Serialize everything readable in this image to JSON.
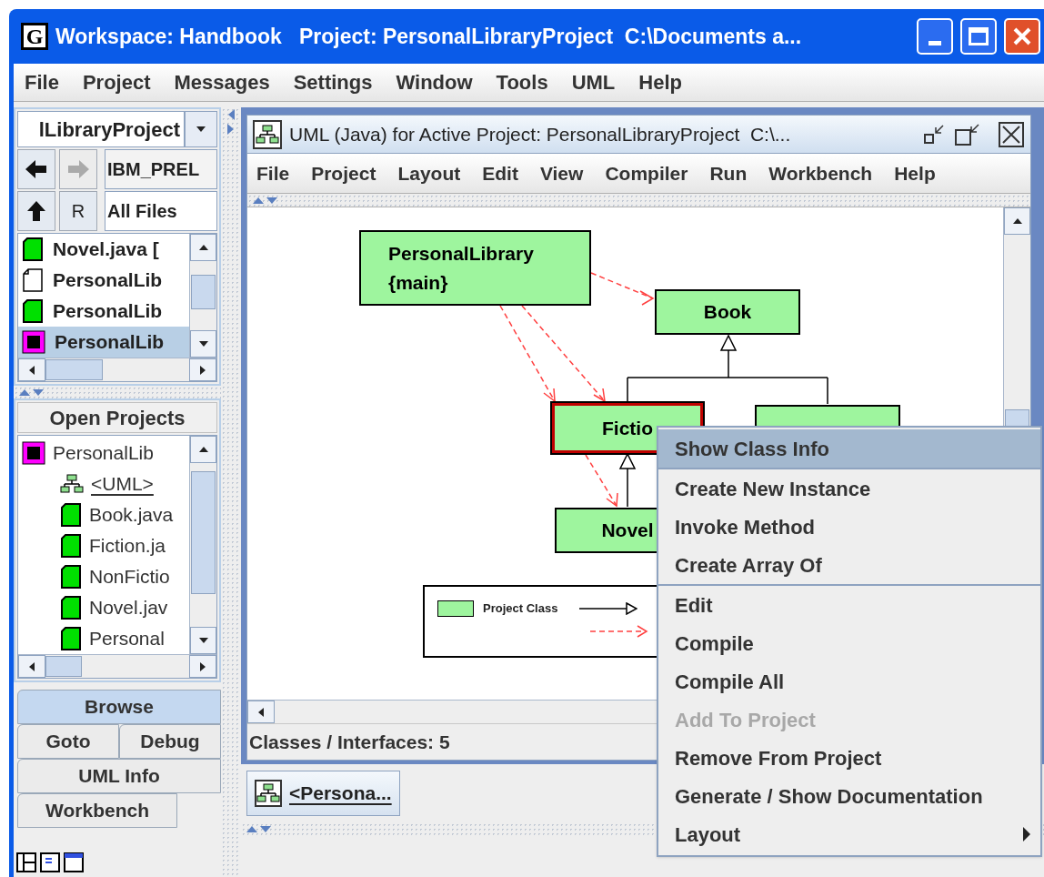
{
  "window": {
    "app_icon": "G",
    "title": "Workspace: Handbook   Project: PersonalLibraryProject  C:\\Documents a..."
  },
  "menubar": [
    "File",
    "Project",
    "Messages",
    "Settings",
    "Window",
    "Tools",
    "UML",
    "Help"
  ],
  "browser": {
    "project_combo": "lLibraryProject",
    "nav_buttons": [
      {
        "kind": "back",
        "disabled": false
      },
      {
        "kind": "forward",
        "disabled": true
      }
    ],
    "location": "IBM_PREL",
    "refresh": "R",
    "filter": "All Files",
    "files": [
      {
        "label": "Novel.java [",
        "kind": "java",
        "selected": false
      },
      {
        "label": "PersonalLib",
        "kind": "file",
        "selected": false
      },
      {
        "label": "PersonalLib",
        "kind": "java",
        "selected": false
      },
      {
        "label": "PersonalLib",
        "kind": "project",
        "selected": true
      }
    ]
  },
  "open_projects": {
    "title": "Open Projects",
    "tree": [
      {
        "label": "PersonalLib",
        "kind": "project",
        "children": [
          {
            "label": "<UML>",
            "kind": "uml"
          },
          {
            "label": "Book.java",
            "kind": "java"
          },
          {
            "label": "Fiction.ja",
            "kind": "java"
          },
          {
            "label": "NonFictio",
            "kind": "java"
          },
          {
            "label": "Novel.jav",
            "kind": "java"
          },
          {
            "label": "Personal",
            "kind": "java"
          }
        ]
      }
    ]
  },
  "tabs": [
    [
      {
        "label": "Browse",
        "selected": true
      }
    ],
    [
      {
        "label": "Goto",
        "selected": false
      },
      {
        "label": "Debug",
        "selected": false
      }
    ],
    [
      {
        "label": "UML Info",
        "selected": false
      }
    ],
    [
      {
        "label": "Workbench",
        "selected": false
      }
    ]
  ],
  "uml_window": {
    "title": "UML (Java) for Active Project: PersonalLibraryProject  C:\\...",
    "menubar": [
      "File",
      "Project",
      "Layout",
      "Edit",
      "View",
      "Compiler",
      "Run",
      "Workbench",
      "Help"
    ],
    "nodes": [
      {
        "lines": [
          "PersonalLibrary",
          "{main}"
        ],
        "selected": false
      },
      {
        "lines": [
          "Book"
        ],
        "selected": false
      },
      {
        "lines": [
          "Fictio"
        ],
        "selected": true
      },
      {
        "selected": false
      },
      {
        "lines": [
          "Novel"
        ],
        "selected": false
      }
    ],
    "legend": {
      "label": "Project Class"
    },
    "status": "Classes / Interfaces: 5"
  },
  "taskbar": [
    {
      "label": "<Persona..."
    }
  ],
  "context_menu": [
    [
      {
        "label": "Show Class Info",
        "selected": true,
        "disabled": false
      }
    ],
    [
      {
        "label": "Create New Instance",
        "selected": false,
        "disabled": false
      },
      {
        "label": "Invoke Method",
        "selected": false,
        "disabled": false
      },
      {
        "label": "Create Array Of",
        "selected": false,
        "disabled": false
      }
    ],
    [
      {
        "label": "Edit",
        "selected": false,
        "disabled": false
      },
      {
        "label": "Compile",
        "selected": false,
        "disabled": false
      },
      {
        "label": "Compile All",
        "selected": false,
        "disabled": false
      },
      {
        "label": "Add To Project",
        "selected": false,
        "disabled": true
      },
      {
        "label": "Remove From Project",
        "selected": false,
        "disabled": false
      },
      {
        "label": "Generate / Show Documentation",
        "selected": false,
        "disabled": false
      },
      {
        "label": "Layout",
        "selected": false,
        "disabled": false,
        "submenu": true
      }
    ]
  ]
}
